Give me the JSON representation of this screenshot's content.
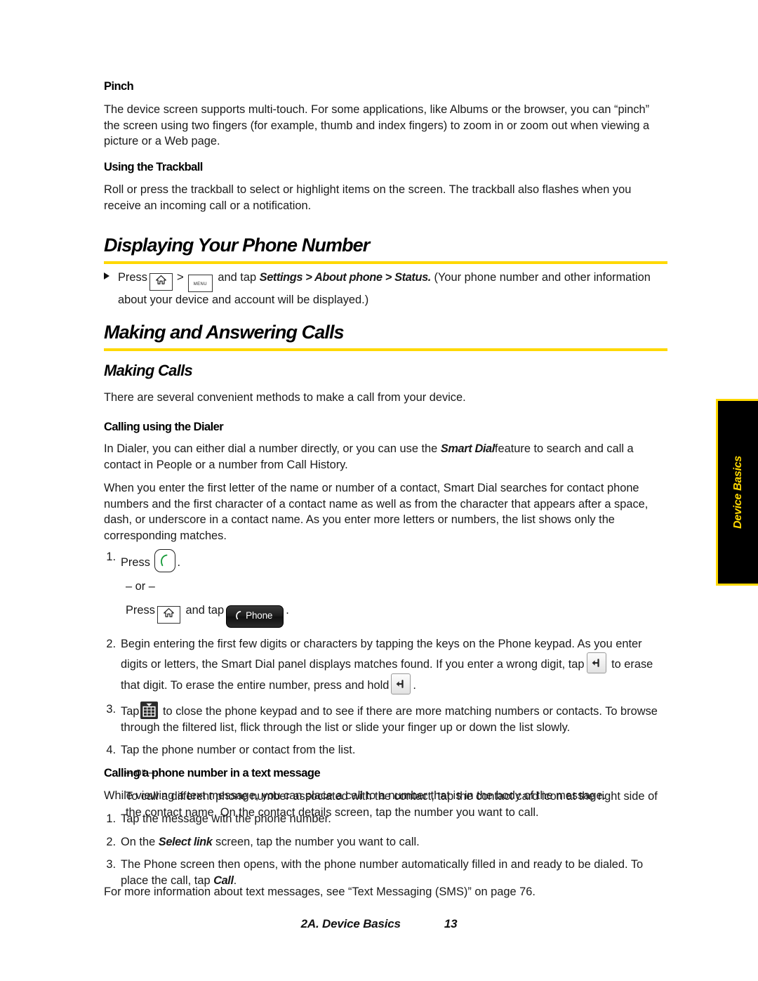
{
  "document": {
    "sections": {
      "pinch": {
        "heading": "Pinch",
        "paragraph": "The device screen supports multi-touch. For some applications, like Albums or the browser, you can “pinch” the screen using two fingers (for example, thumb and index fingers) to zoom in or zoom out when viewing a picture or a Web page."
      },
      "trackball": {
        "heading": "Using the Trackball",
        "paragraph": "Roll or press the trackball to select or highlight items on the screen. The trackball also flashes when you receive an incoming call or a notification."
      },
      "displaying_phone_number": {
        "heading": "Displaying Your Phone Number",
        "bullet_pre": "Press",
        "bullet_sep": ">",
        "bullet_mid": "and tap",
        "bullet_path": "Settings > About phone > Status.",
        "bullet_post": "(Your phone number and other information about your device and account will be displayed.)",
        "icon_home": "home-icon",
        "icon_menu_label": "menu"
      },
      "making_and_answering_calls": {
        "heading": "Making and Answering Calls"
      },
      "making_calls": {
        "heading": "Making Calls",
        "paragraph": "There are several convenient methods to make a call from your device."
      },
      "calling_using_dialer": {
        "heading": "Calling using the Dialer",
        "paragraph1_a": "In Dialer, you can either dial a number directly, or you can use the",
        "paragraph1_em": "Smart Dial",
        "paragraph1_b": "feature to search and call a contact in People or a number from Call History.",
        "paragraph2": "When you enter the first letter of the name or number of a contact, Smart Dial searches for contact phone numbers and the first character of a contact name as well as from the character that appears after a space, dash, or underscore in a contact name. As you enter more letters or numbers, the list shows only the corresponding matches.",
        "steps": {
          "s1_num": "1.",
          "s1_press": "Press",
          "s1_period": ".",
          "s1_or": "– or –",
          "s1_alt_press": "Press",
          "s1_alt_and_tap": "and tap",
          "s1_alt_period": ".",
          "phone_button_label": "Phone",
          "s2_num": "2.",
          "s2_a": "Begin entering the first few digits or characters by tapping the keys on the Phone keypad. As you enter digits or letters, the Smart Dial panel displays matches found. If you enter a wrong digit, tap",
          "s2_b": "to erase that digit. To erase the entire number, press and hold",
          "s2_c": ".",
          "s3_num": "3.",
          "s3_a": "Tap",
          "s3_b": "to close the phone keypad and to see if there are more matching numbers or contacts. To browse through the filtered list, flick through the list or slide your finger up or down the list slowly.",
          "s4_num": "4.",
          "s4_a": "Tap the phone number or contact from the list.",
          "s4_or": "– or –",
          "s4_alt": "To call a different phone number associated with the contact, tap the contact card icon at the right side of the contact name. On the contact details screen, tap the number you want to call."
        }
      },
      "calling_in_text_message": {
        "heading": "Calling a phone number in a text message",
        "paragraph": "While viewing a text message, you can place a call to a number that is in the body of the message.",
        "steps": [
          {
            "num": "1.",
            "text": "Tap the message with the phone number."
          },
          {
            "num": "2.",
            "pre": "On the",
            "em": "Select link",
            "post": "screen, tap the number you want to call."
          },
          {
            "num": "3.",
            "pre": "The Phone screen then opens, with the phone number automatically filled in and ready to be dialed. To place the call, tap",
            "em": "Call",
            "post": "."
          }
        ],
        "closing": "For more information about text messages, see “Text Messaging (SMS)” on page 76."
      }
    },
    "side_tab": {
      "label": "Device Basics"
    },
    "footer": {
      "chapter": "2A. Device Basics",
      "page_number": "13"
    },
    "colors": {
      "accent_yellow": "#ffd800",
      "tab_background": "#000000",
      "call_green": "#1a9c3c",
      "text": "#1a1a1a"
    }
  }
}
